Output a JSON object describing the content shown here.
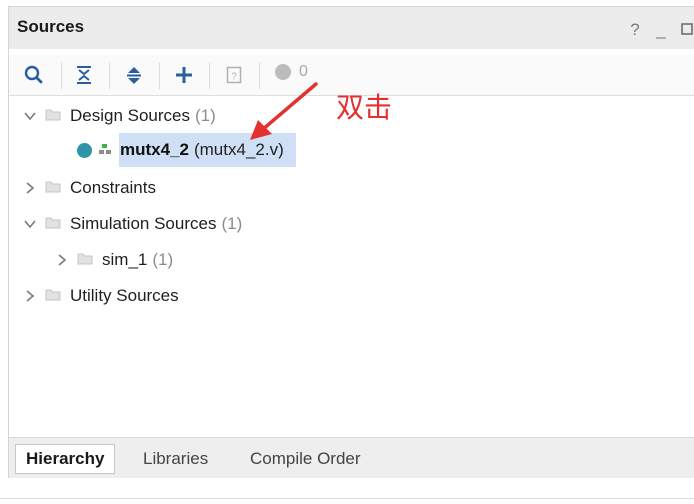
{
  "panel": {
    "title": "Sources",
    "window_controls": {
      "help": "?",
      "minimize": "_"
    }
  },
  "toolbar": {
    "icons": [
      "search-icon",
      "collapse-all-icon",
      "expand-all-icon",
      "add-icon",
      "properties-icon"
    ],
    "status_count": "0"
  },
  "tree": {
    "design_sources": {
      "label": "Design Sources",
      "count": "(1)"
    },
    "design_module": {
      "name": "mutx4_2",
      "file": "(mutx4_2.v)"
    },
    "constraints": {
      "label": "Constraints"
    },
    "simulation_sources": {
      "label": "Simulation Sources",
      "count": "(1)"
    },
    "sim_1": {
      "label": "sim_1",
      "count": "(1)"
    },
    "utility_sources": {
      "label": "Utility Sources"
    }
  },
  "annotation": {
    "text": "双击",
    "color": "#e53030"
  },
  "tabs": [
    {
      "label": "Hierarchy",
      "active": true
    },
    {
      "label": "Libraries",
      "active": false
    },
    {
      "label": "Compile Order",
      "active": false
    }
  ],
  "colors": {
    "accent_blue": "#2a6bbf",
    "selection": "#cfe0f6",
    "module_dot": "#2c96a8"
  }
}
